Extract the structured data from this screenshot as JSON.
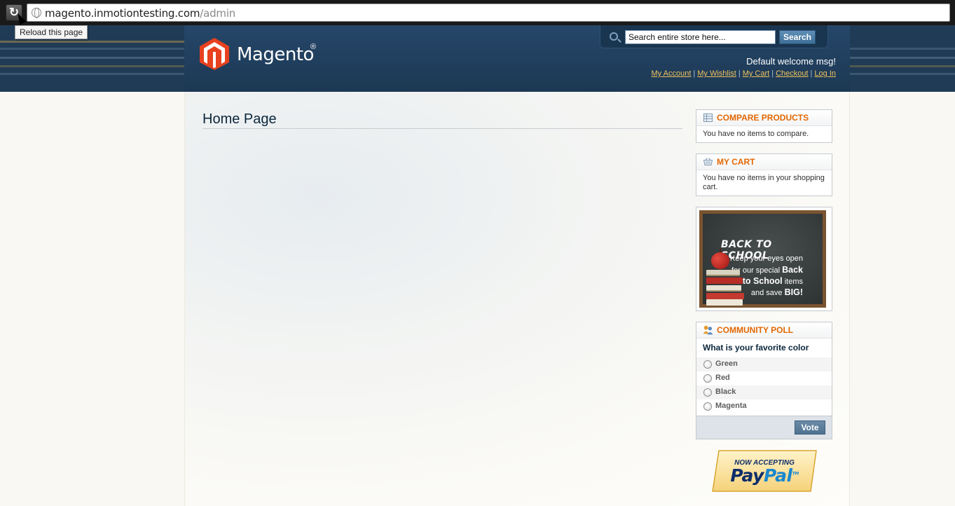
{
  "browser": {
    "url_host": "magento.inmotiontesting.com",
    "url_path": "/admin",
    "reload_tooltip": "Reload this page",
    "reload_icon": "reload-icon"
  },
  "header": {
    "logo_text": "Magento",
    "logo_reg": "®",
    "search_placeholder": "Search entire store here...",
    "search_button": "Search",
    "welcome": "Default welcome msg!",
    "links": [
      "My Account",
      "My Wishlist",
      "My Cart",
      "Checkout",
      "Log In"
    ],
    "link_separator": "|"
  },
  "main": {
    "page_title": "Home Page"
  },
  "sidebar": {
    "compare": {
      "title": "Compare Products",
      "text": "You have no items to compare."
    },
    "cart": {
      "title": "My Cart",
      "text": "You have no items in your shopping cart."
    },
    "banner": {
      "headline": "BACK TO SCHOOL",
      "line1": "Keep your eyes open",
      "line2": "for our special",
      "line2_bold": "Back",
      "line3_bold": "to School",
      "line3": "items",
      "line4": "and save",
      "line4_bold": "BIG!"
    },
    "poll": {
      "title": "Community Poll",
      "question": "What is your favorite color",
      "options": [
        "Green",
        "Red",
        "Black",
        "Magenta"
      ],
      "vote_button": "Vote"
    },
    "paypal": {
      "top": "NOW ACCEPTING",
      "logo_pay": "Pay",
      "logo_pal": "Pal",
      "tm": "TM"
    }
  },
  "colors": {
    "header_bg": "#203b56",
    "accent_orange": "#e26703",
    "link_yellow": "#eec25e",
    "title_navy": "#0a263c"
  }
}
